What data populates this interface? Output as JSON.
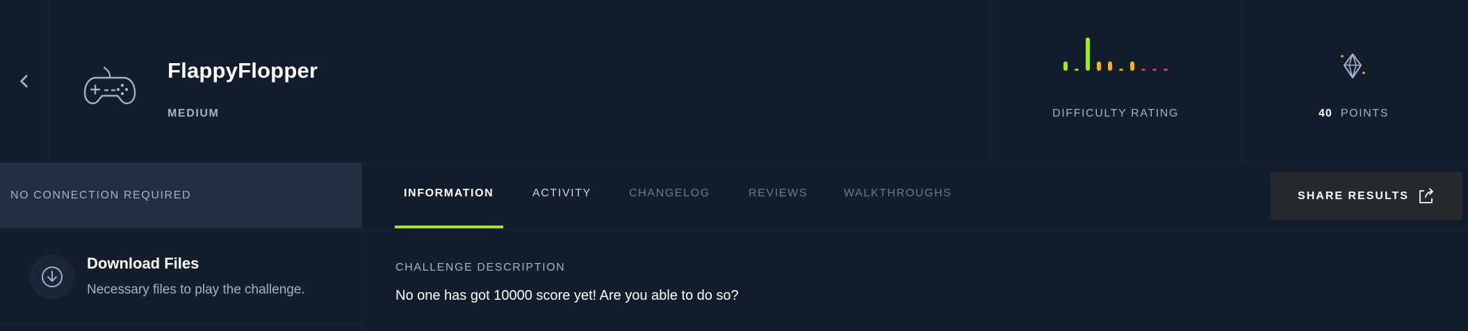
{
  "header": {
    "title": "FlappyFlopper",
    "difficulty": "MEDIUM",
    "rating_label": "DIFFICULTY RATING",
    "points_value": "40",
    "points_label": "POINTS"
  },
  "difficulty_rating": {
    "bars": [
      {
        "level": 0.28,
        "color": "#9fef00"
      },
      {
        "level": 0.05,
        "color": "#9fef00"
      },
      {
        "level": 1.0,
        "color": "#9fef00"
      },
      {
        "level": 0.28,
        "color": "#ffaf00"
      },
      {
        "level": 0.28,
        "color": "#ffaf00"
      },
      {
        "level": 0.05,
        "color": "#ffaf00"
      },
      {
        "level": 0.28,
        "color": "#ffaf00"
      },
      {
        "level": 0.05,
        "color": "#ff3e3e"
      },
      {
        "level": 0.05,
        "color": "#ff3e3e"
      },
      {
        "level": 0.05,
        "color": "#ff3e3e"
      }
    ]
  },
  "connection": {
    "label": "NO CONNECTION REQUIRED"
  },
  "download": {
    "title": "Download Files",
    "description": "Necessary files to play the challenge."
  },
  "tabs": [
    {
      "label": "INFORMATION",
      "state": "active"
    },
    {
      "label": "ACTIVITY",
      "state": "normal"
    },
    {
      "label": "CHANGELOG",
      "state": "dim"
    },
    {
      "label": "REVIEWS",
      "state": "dim"
    },
    {
      "label": "WALKTHROUGHS",
      "state": "dim"
    }
  ],
  "share": {
    "label": "SHARE RESULTS"
  },
  "content": {
    "section_heading": "CHALLENGE DESCRIPTION",
    "description": "No one has got 10000 score yet! Are you able to do so?"
  },
  "colors": {
    "background": "#141d2b",
    "panel": "#232e40",
    "accent": "#9fef00",
    "medium": "#ffaf00",
    "hard": "#ff3e3e",
    "muted_text": "#a4b1cd"
  }
}
